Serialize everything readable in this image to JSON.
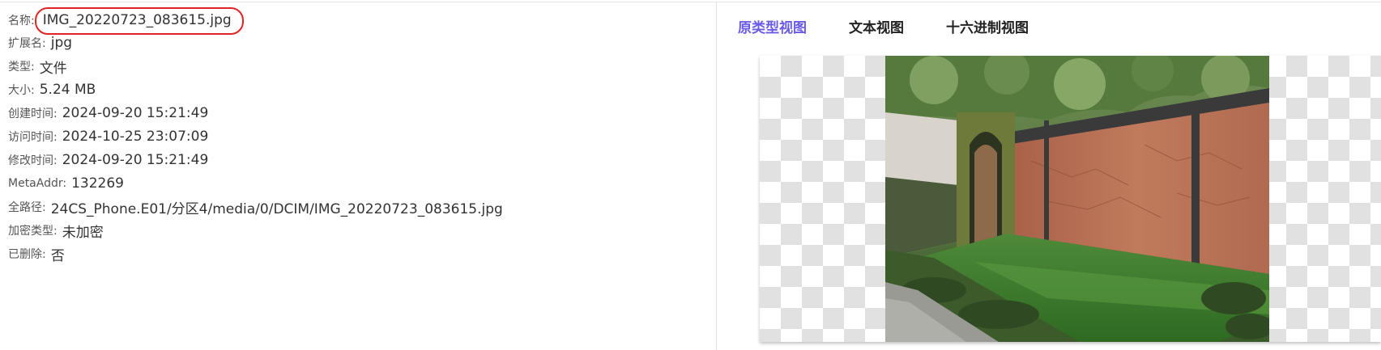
{
  "properties": {
    "name": {
      "label": "名称:",
      "value": "IMG_20220723_083615.jpg"
    },
    "extension": {
      "label": "扩展名:",
      "value": "jpg"
    },
    "type": {
      "label": "类型:",
      "value": "文件"
    },
    "size": {
      "label": "大小:",
      "value": "5.24 MB"
    },
    "created": {
      "label": "创建时间:",
      "value": "2024-09-20 15:21:49"
    },
    "accessed": {
      "label": "访问时间:",
      "value": "2024-10-25 23:07:09"
    },
    "modified": {
      "label": "修改时间:",
      "value": "2024-09-20 15:21:49"
    },
    "meta_addr": {
      "label": "MetaAddr:",
      "value": "132269"
    },
    "full_path": {
      "label": "全路径:",
      "value": "24CS_Phone.E01/分区4/media/0/DCIM/IMG_20220723_083615.jpg"
    },
    "encryption": {
      "label": "加密类型:",
      "value": "未加密"
    },
    "deleted": {
      "label": "已删除:",
      "value": "否"
    }
  },
  "preview": {
    "tabs": [
      {
        "label": "原类型视图",
        "active": true
      },
      {
        "label": "文本视图",
        "active": false
      },
      {
        "label": "十六进制视图",
        "active": false
      }
    ]
  },
  "colors": {
    "active_tab": "#6a5be6",
    "highlight_mark": "#e02424"
  }
}
